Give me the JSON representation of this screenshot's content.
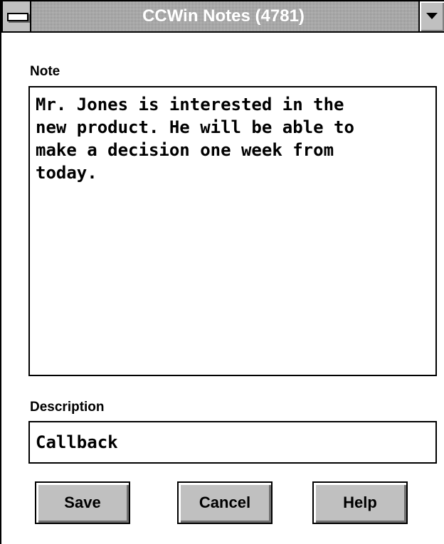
{
  "window": {
    "title": "CCWin Notes (4781)",
    "system_menu_icon": "system-menu-icon",
    "minimize_icon": "minimize-arrow-icon"
  },
  "note": {
    "label": "Note",
    "value": "Mr. Jones is interested in the\nnew product. He will be able to\nmake a decision one week from\ntoday."
  },
  "description": {
    "label": "Description",
    "value": "Callback"
  },
  "buttons": {
    "save": "Save",
    "cancel": "Cancel",
    "help": "Help"
  },
  "colors": {
    "title_bar": "#a8a8a8",
    "title_text": "#ffffff",
    "button_face": "#c0c0c0"
  }
}
